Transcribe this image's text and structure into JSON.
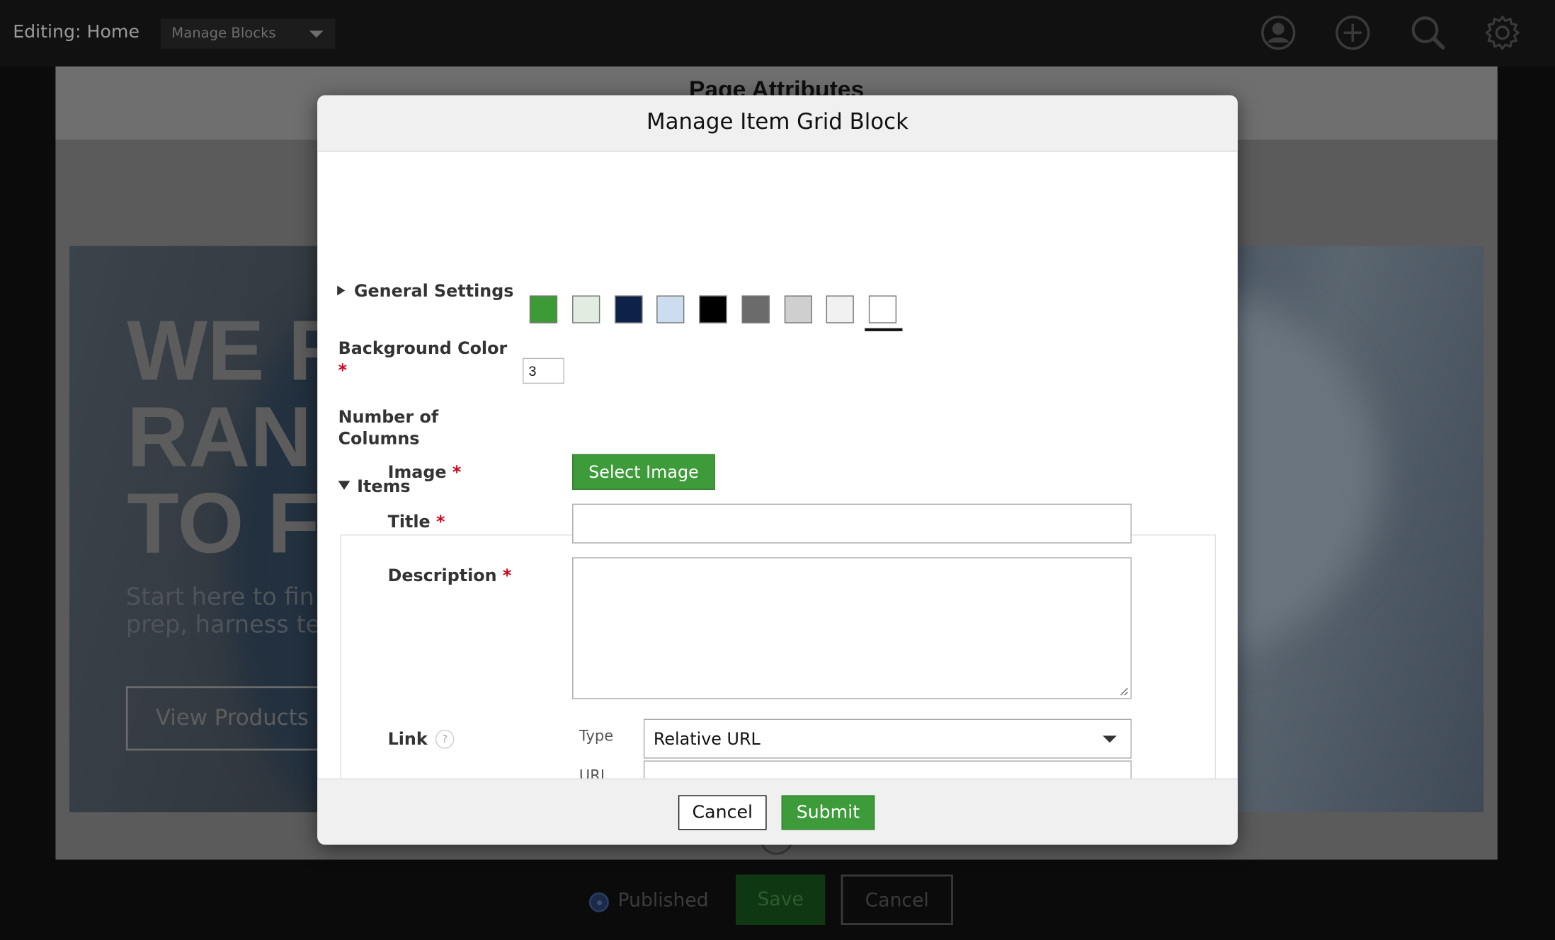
{
  "toolbar": {
    "editing_label": "Editing: Home",
    "manage_blocks_label": "Manage Blocks",
    "icons": [
      "user-icon",
      "add-icon",
      "search-icon",
      "gear-icon"
    ]
  },
  "page": {
    "header_title": "Page Attributes",
    "hero_heading": "WE R\nRAN\nTO F",
    "hero_subtext": "Start here to fin\nprep, harness te",
    "hero_button": "View Products",
    "published_label": "Published",
    "save_label": "Save",
    "cancel_label": "Cancel"
  },
  "modal": {
    "title": "Manage Item Grid Block",
    "general_settings": "General Settings",
    "background_color_label": "Background Color",
    "required_mark": "*",
    "swatches": [
      "#3d9b35",
      "#e1ede0",
      "#0e2148",
      "#cdddf0",
      "#000000",
      "#6b6b6b",
      "#cfcfcf",
      "#f1f1f1",
      "#ffffff"
    ],
    "selected_swatch": "#ffffff",
    "columns_label": "Number of Columns",
    "columns_value": "3",
    "items_label": "Items",
    "add_item_glyph": "+",
    "item": {
      "image_label": "Image",
      "select_image_button": "Select Image",
      "title_label": "Title",
      "title_value": "",
      "description_label": "Description",
      "description_value": "",
      "link_label": "Link",
      "help_glyph": "?",
      "type_label": "Type",
      "type_value": "Relative URL",
      "url_label": "URL"
    },
    "cancel_button": "Cancel",
    "submit_button": "Submit"
  }
}
